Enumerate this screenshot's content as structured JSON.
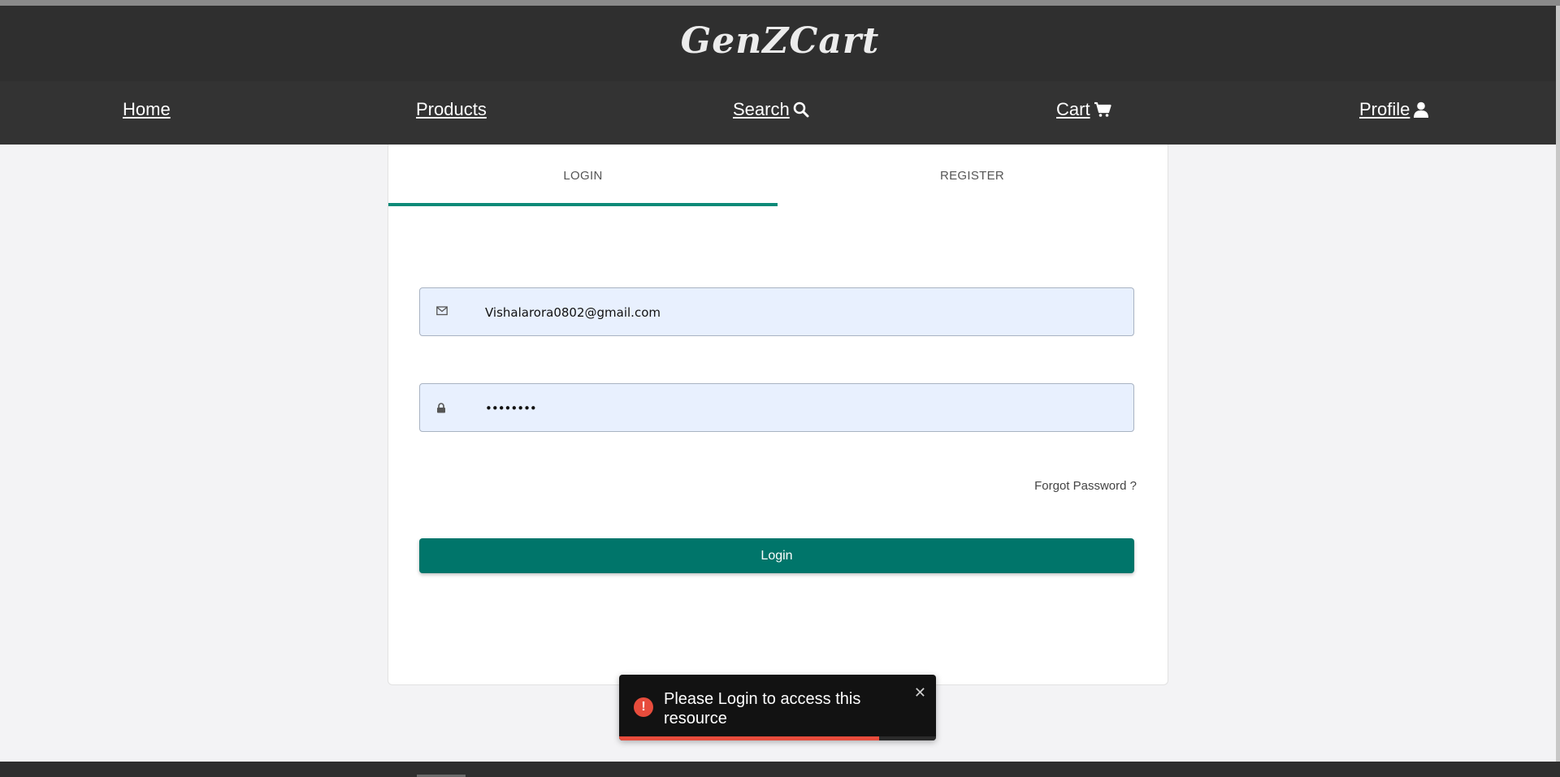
{
  "brand": {
    "name": "GenZCart"
  },
  "nav": {
    "home": "Home",
    "products": "Products",
    "search": "Search",
    "cart": "Cart",
    "profile": "Profile"
  },
  "icons": {
    "search": "search-icon",
    "cart": "cart-icon",
    "profile": "user-icon",
    "email": "mail-icon",
    "password": "lock-icon",
    "toast": "error-icon",
    "close": "close-icon"
  },
  "auth": {
    "tabs": {
      "login": "LOGIN",
      "register": "REGISTER",
      "active": "login"
    },
    "email_value": "Vishalarora0802@gmail.com",
    "password_value": "••••••••",
    "forgot": "Forgot Password ?",
    "login_button": "Login"
  },
  "toast": {
    "message": "Please Login to access this resource",
    "close": "✕",
    "progress": 0.82
  },
  "colors": {
    "accent": "#00756a",
    "tab_indicator": "#0b8a78",
    "error": "#e74c3c",
    "header": "#2f2f2f"
  }
}
